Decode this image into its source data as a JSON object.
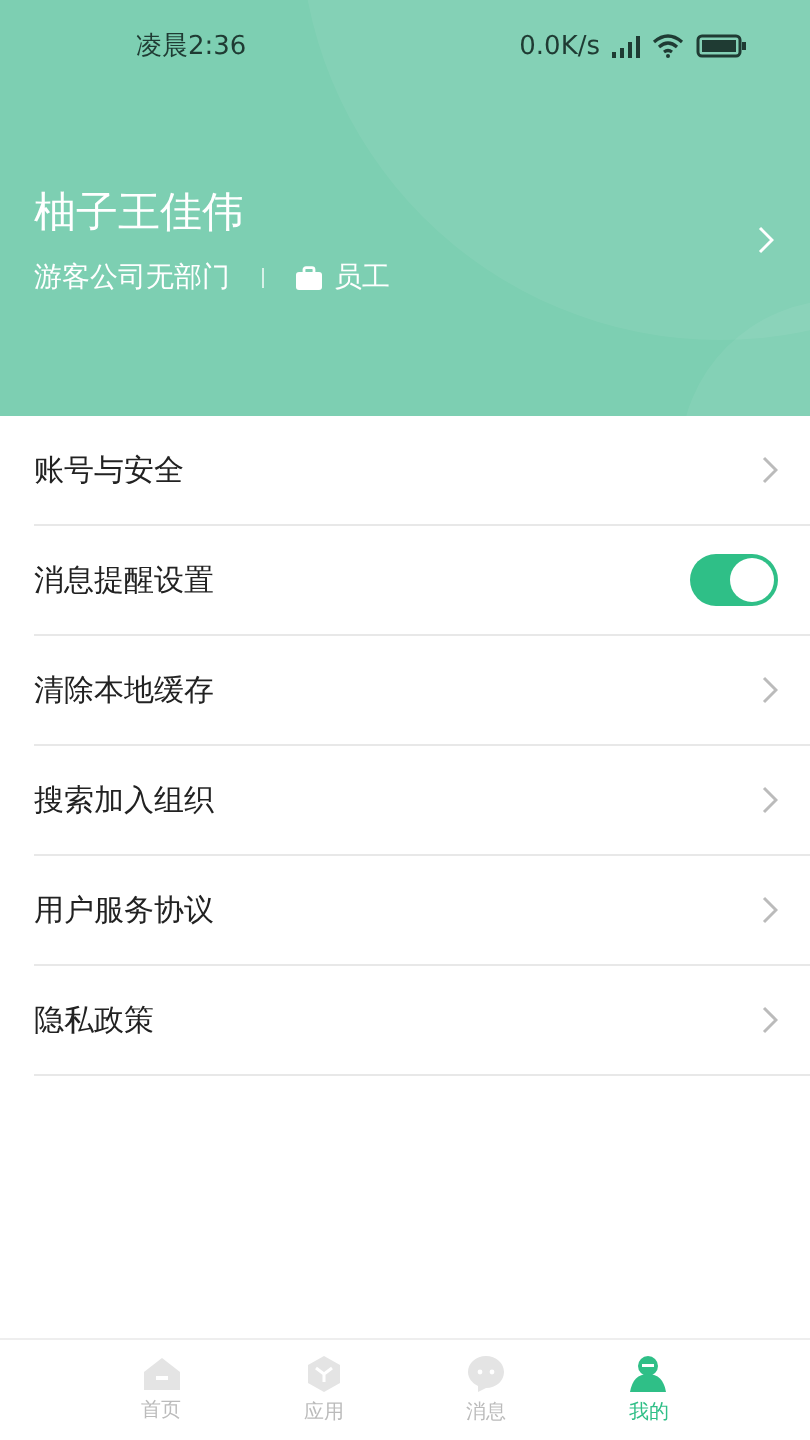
{
  "status_bar": {
    "time": "凌晨2:36",
    "speed": "0.0K/s"
  },
  "profile": {
    "name": "柚子王佳伟",
    "company": "游客公司无部门",
    "role": "员工"
  },
  "menu": [
    {
      "kind": "link",
      "label": "账号与安全"
    },
    {
      "kind": "toggle",
      "label": "消息提醒设置",
      "on": true
    },
    {
      "kind": "link",
      "label": "清除本地缓存"
    },
    {
      "kind": "link",
      "label": "搜索加入组织"
    },
    {
      "kind": "link",
      "label": "用户服务协议"
    },
    {
      "kind": "link",
      "label": "隐私政策"
    }
  ],
  "tabs": [
    {
      "kind": "home",
      "label": "首页",
      "selected": false
    },
    {
      "kind": "cube",
      "label": "应用",
      "selected": false
    },
    {
      "kind": "chat",
      "label": "消息",
      "selected": false
    },
    {
      "kind": "person",
      "label": "我的",
      "selected": true
    }
  ]
}
